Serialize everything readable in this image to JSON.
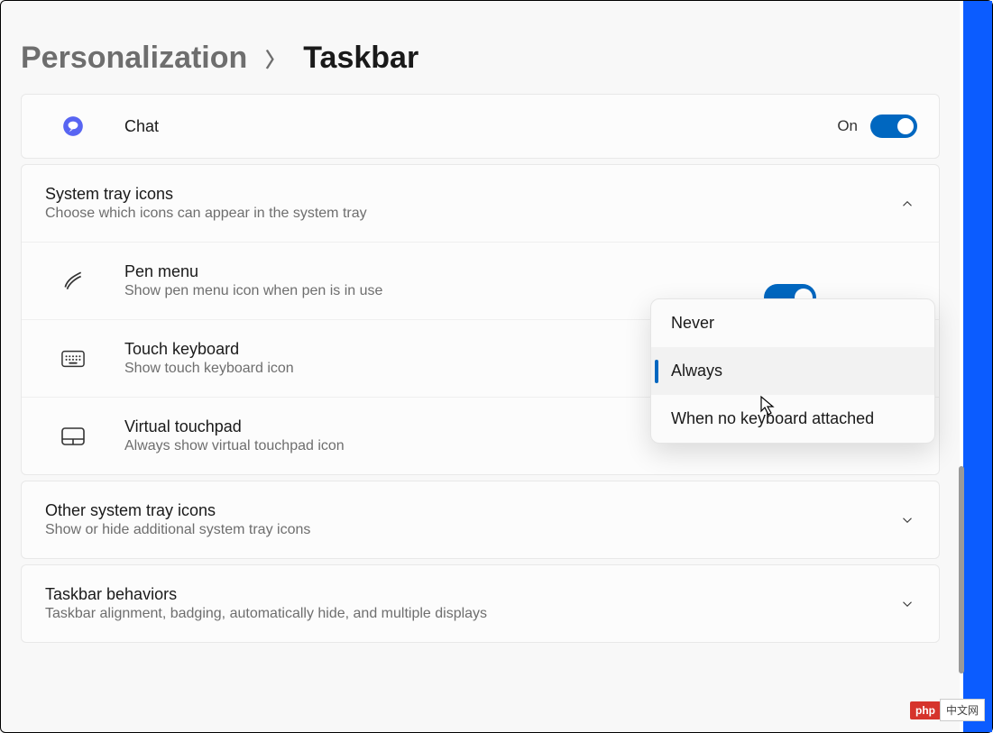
{
  "breadcrumb": {
    "parent": "Personalization",
    "current": "Taskbar"
  },
  "chat": {
    "label": "Chat",
    "state_label": "On",
    "state": "on"
  },
  "system_tray": {
    "title": "System tray icons",
    "sub": "Choose which icons can appear in the system tray",
    "expanded": true,
    "items": [
      {
        "title": "Pen menu",
        "sub": "Show pen menu icon when pen is in use"
      },
      {
        "title": "Touch keyboard",
        "sub": "Show touch keyboard icon"
      },
      {
        "title": "Virtual touchpad",
        "sub": "Always show virtual touchpad icon"
      }
    ]
  },
  "touch_keyboard_menu": {
    "options": [
      "Never",
      "Always",
      "When no keyboard attached"
    ],
    "selected": "Always"
  },
  "other_tray": {
    "title": "Other system tray icons",
    "sub": "Show or hide additional system tray icons",
    "expanded": false
  },
  "behaviors": {
    "title": "Taskbar behaviors",
    "sub": "Taskbar alignment, badging, automatically hide, and multiple displays",
    "expanded": false
  },
  "watermark": {
    "left": "php",
    "right": "中⽂⽹"
  }
}
